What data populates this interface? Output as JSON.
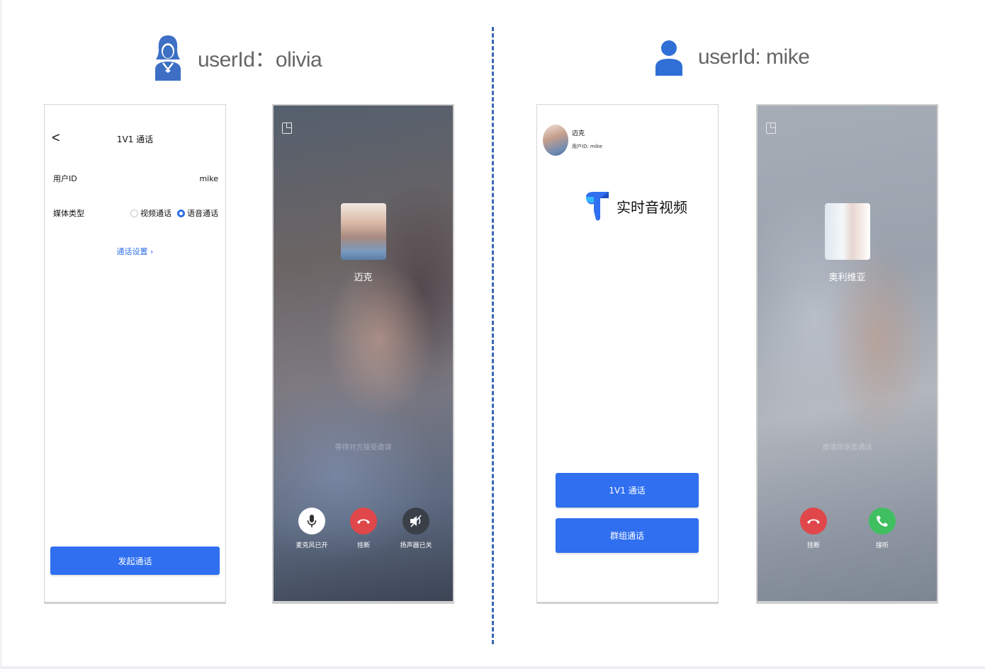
{
  "left_user": {
    "label": "userId：olivia",
    "icon": "female-user-icon"
  },
  "right_user": {
    "label": "userId: mike",
    "icon": "user-icon"
  },
  "colors": {
    "accent": "#2f6ff0",
    "divider": "#3a66b5",
    "hangup": "#e0474a",
    "answer": "#3fbf5f"
  },
  "screen1": {
    "back": "<",
    "title": "1V1 通话",
    "user_id_label": "用户ID",
    "user_id_value": "mike",
    "media_label": "媒体类型",
    "option_video": "视频通话",
    "option_audio": "语音通话",
    "selected": "语音通话",
    "settings_link": "通话设置 ›",
    "start_button": "发起通话"
  },
  "screen2": {
    "callee_name": "迈克",
    "status": "等待对方接受邀请",
    "controls": [
      {
        "label": "麦克风已开",
        "icon": "microphone-icon"
      },
      {
        "label": "挂断",
        "icon": "hangup-icon"
      },
      {
        "label": "扬声器已关",
        "icon": "speaker-off-icon"
      }
    ]
  },
  "screen3": {
    "user_name": "迈克",
    "user_id": "用户ID: mike",
    "brand": "实时音视频",
    "btn_1v1": "1V1 通话",
    "btn_group": "群组通话"
  },
  "screen4": {
    "caller_name": "奥利维亚",
    "status": "邀请你语音通话",
    "controls": [
      {
        "label": "挂断",
        "icon": "hangup-icon"
      },
      {
        "label": "接听",
        "icon": "answer-icon"
      }
    ]
  }
}
